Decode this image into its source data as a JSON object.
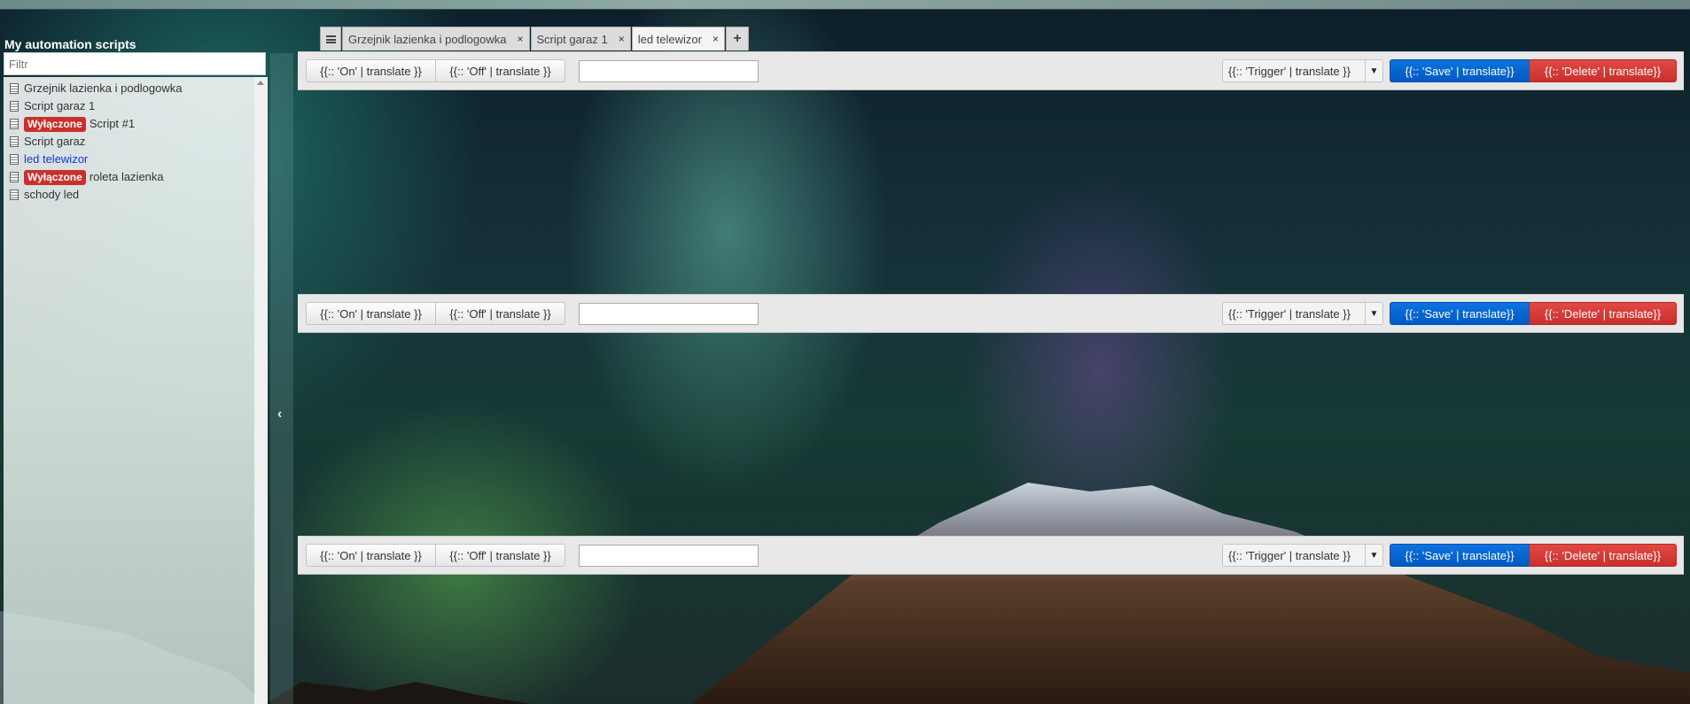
{
  "sidebar": {
    "title": "My automation scripts",
    "filter_placeholder": "Filtr",
    "items": [
      {
        "label": "Grzejnik lazienka i podlogowka",
        "badge": ""
      },
      {
        "label": "Script garaz 1",
        "badge": ""
      },
      {
        "label": "Script #1",
        "badge": "Wyłączone"
      },
      {
        "label": "Script garaz",
        "badge": ""
      },
      {
        "label": "led telewizor",
        "badge": "",
        "active": true
      },
      {
        "label": "roleta lazienka",
        "badge": "Wyłączone"
      },
      {
        "label": "schody led",
        "badge": ""
      }
    ]
  },
  "tabs": [
    {
      "label": "Grzejnik lazienka i podlogowka",
      "close": "×"
    },
    {
      "label": "Script garaz 1",
      "close": "×"
    },
    {
      "label": "led telewizor",
      "close": "×",
      "active": true
    }
  ],
  "tab_add": "+",
  "toolbars": [
    {
      "on_label": "{{:: 'On' | translate }}",
      "off_label": "{{:: 'Off' | translate }}",
      "name_value": "",
      "trigger_label": "{{:: 'Trigger' | translate }}",
      "save_label": "{{:: 'Save' | translate}}",
      "delete_label": "{{:: 'Delete' | translate}}"
    },
    {
      "on_label": "{{:: 'On' | translate }}",
      "off_label": "{{:: 'Off' | translate }}",
      "name_value": "",
      "trigger_label": "{{:: 'Trigger' | translate }}",
      "save_label": "{{:: 'Save' | translate}}",
      "delete_label": "{{:: 'Delete' | translate}}"
    },
    {
      "on_label": "{{:: 'On' | translate }}",
      "off_label": "{{:: 'Off' | translate }}",
      "name_value": "",
      "trigger_label": "{{:: 'Trigger' | translate }}",
      "save_label": "{{:: 'Save' | translate}}",
      "delete_label": "{{:: 'Delete' | translate}}"
    }
  ],
  "icons": {
    "tab_menu": "hamburger-icon",
    "collapse": "chevron-left-icon",
    "item": "document-icon",
    "trigger_caret": "caret-down-icon"
  },
  "colors": {
    "save": "#0d6ad6",
    "delete": "#d9413b",
    "badge": "#c9302c",
    "active_item": "#1538d0"
  }
}
